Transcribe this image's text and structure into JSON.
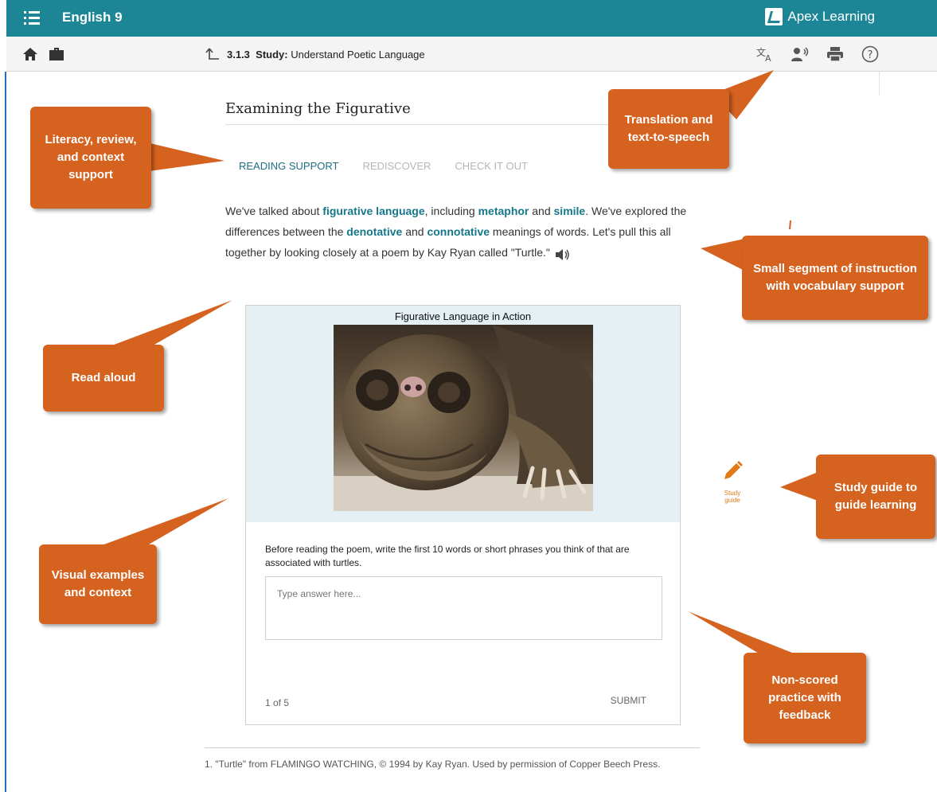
{
  "header": {
    "course_title": "English 9",
    "brand_name": "Apex Learning",
    "icons": [
      "menu-icon"
    ]
  },
  "subbar": {
    "lesson_number": "3.1.3",
    "lesson_kind": "Study:",
    "lesson_title": "Understand Poetic Language",
    "icons": [
      "home-icon",
      "briefcase-icon",
      "up-arrow-icon",
      "translate-icon",
      "text-to-speech-icon",
      "print-icon",
      "help-icon"
    ]
  },
  "content": {
    "title": "Examining the Figurative",
    "tabs": [
      {
        "label": "READING SUPPORT",
        "active": true
      },
      {
        "label": "REDISCOVER",
        "active": false
      },
      {
        "label": "CHECK IT OUT",
        "active": false
      }
    ],
    "intro": {
      "p1": "We've talked about ",
      "v1": "figurative language",
      "p2": ", including ",
      "v2": "metaphor",
      "p3": " and ",
      "v3": "simile",
      "p4": ". We've explored the differences between the ",
      "v4": "denotative",
      "p5": " and ",
      "v5": "connotative",
      "p6": " meanings of words. Let's pull this all together by looking closely at a poem by Kay Ryan called \"Turtle.\""
    }
  },
  "card": {
    "title": "Figurative Language in Action",
    "prompt": "Before reading the poem, write the first 10 words or short phrases you think of that are associated with turtles.",
    "answer_value": "",
    "answer_placeholder": "Type answer here...",
    "counter": "1 of 5",
    "submit_label": "SUBMIT"
  },
  "footnote": "1. \"Turtle\" from FLAMINGO WATCHING, © 1994 by Kay Ryan. Used by permission of Copper Beech Press.",
  "study_guide": {
    "label_line1": "Study",
    "label_line2": "guide"
  },
  "callouts": {
    "literacy": "Literacy, review, and context support",
    "translation": "Translation and text-to-speech",
    "segment": "Small segment of instruction with vocabulary support",
    "read_aloud": "Read aloud",
    "study_guide": "Study guide to guide learning",
    "visual": "Visual examples and context",
    "practice": "Non-scored practice with feedback"
  },
  "colors": {
    "header_teal": "#1c8596",
    "vocab_teal": "#16778a",
    "callout_orange": "#d5621f",
    "study_guide_orange": "#e07a16"
  }
}
